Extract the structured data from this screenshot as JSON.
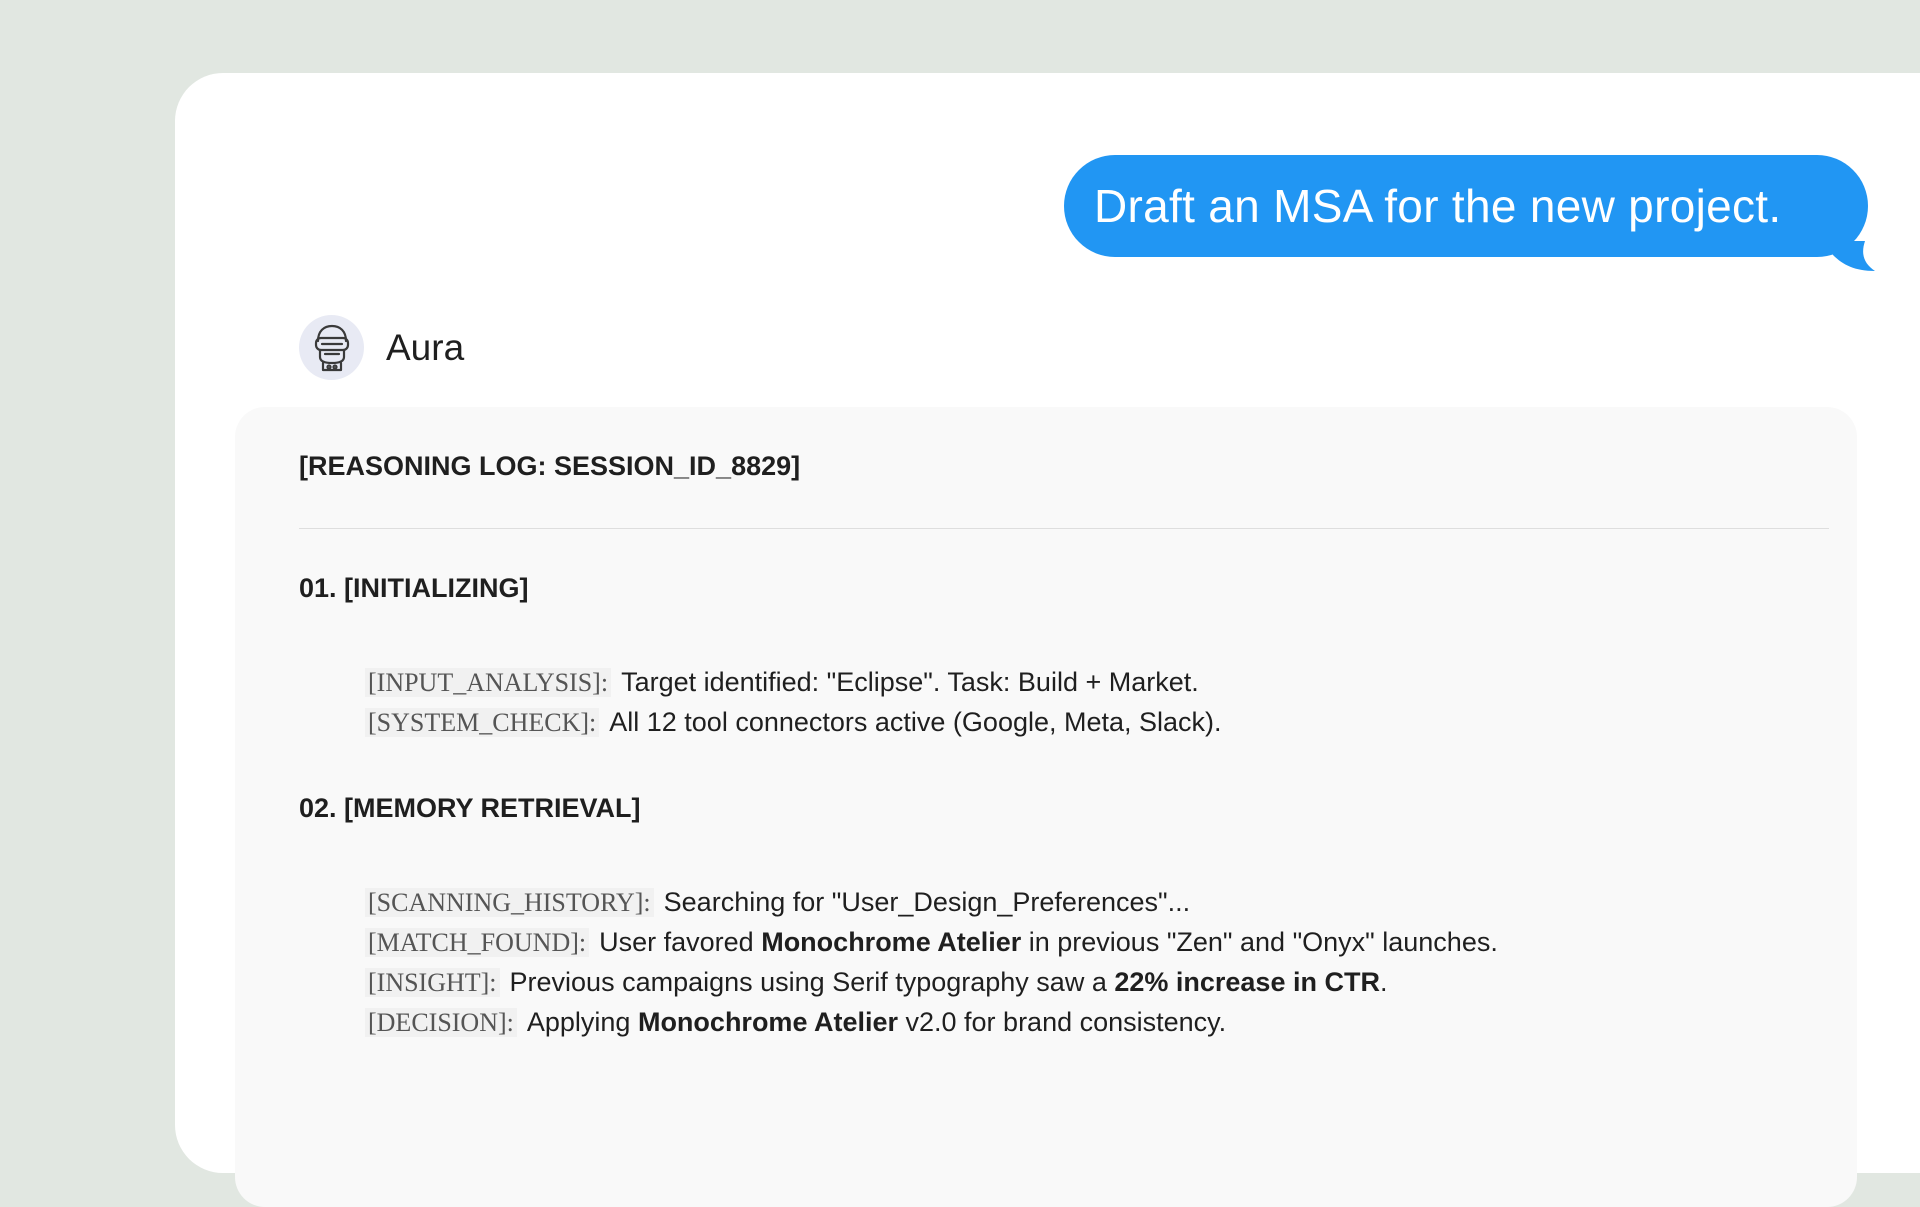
{
  "user_message": "Draft an MSA for the new project.",
  "assistant": {
    "name": "Aura",
    "avatar_icon": "robot-icon"
  },
  "log": {
    "title": "[REASONING LOG: SESSION_ID_8829]",
    "sections": [
      {
        "heading": "01. [INITIALIZING]",
        "lines": [
          {
            "tag": "[INPUT_ANALYSIS]:",
            "parts": [
              "Target identified: \"Eclipse\". Task: Build + Market."
            ]
          },
          {
            "tag": "[SYSTEM_CHECK]:",
            "parts": [
              "All 12 tool connectors active (Google, Meta, Slack)."
            ]
          }
        ]
      },
      {
        "heading": "02. [MEMORY RETRIEVAL]",
        "lines": [
          {
            "tag": "[SCANNING_HISTORY]:",
            "parts": [
              "Searching for \"User_Design_Preferences\"..."
            ]
          },
          {
            "tag": "[MATCH_FOUND]:",
            "parts": [
              "User favored ",
              "Monochrome Atelier",
              " in previous \"Zen\" and \"Onyx\" launches."
            ]
          },
          {
            "tag": "[INSIGHT]:",
            "parts": [
              "Previous campaigns using Serif typography saw a ",
              "22% increase in CTR",
              "."
            ]
          },
          {
            "tag": "[DECISION]:",
            "parts": [
              "Applying ",
              "Monochrome Atelier",
              " v2.0 for brand consistency."
            ]
          }
        ]
      }
    ]
  },
  "colors": {
    "background": "#e1e7e1",
    "user_bubble": "#2196f3",
    "card": "#f9f9f9"
  }
}
